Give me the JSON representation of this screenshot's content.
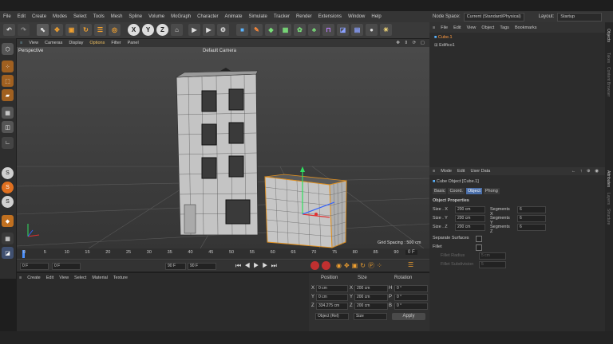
{
  "menubar": {
    "items": [
      "File",
      "Edit",
      "Create",
      "Modes",
      "Select",
      "Tools",
      "Mesh",
      "Spline",
      "Volume",
      "MoGraph",
      "Character",
      "Animate",
      "Simulate",
      "Tracker",
      "Render",
      "Extensions",
      "Window",
      "Help"
    ]
  },
  "nodespace": {
    "label": "Node Space:",
    "value": "Current (Standard/Physical)",
    "layout_label": "Layout:",
    "layout_value": "Startup"
  },
  "toolbar": {
    "x": "X",
    "y": "Y",
    "z": "Z"
  },
  "viewport": {
    "menu": [
      "View",
      "Cameras",
      "Display",
      "Options",
      "Filter",
      "Panel"
    ],
    "name": "Perspective",
    "camera": "Default Camera",
    "grid_spacing": "Grid Spacing : 500 cm"
  },
  "timeline": {
    "ticks": [
      "0",
      "5",
      "10",
      "15",
      "20",
      "25",
      "30",
      "35",
      "40",
      "45",
      "50",
      "55",
      "60",
      "65",
      "70",
      "75",
      "80",
      "85",
      "90"
    ],
    "current": "0 F",
    "start": "0 F",
    "start2": "0 F",
    "end": "90 F",
    "end2": "90 F"
  },
  "materials": {
    "menu": [
      "Create",
      "Edit",
      "View",
      "Select",
      "Material",
      "Texture"
    ]
  },
  "coordinates": {
    "headers": [
      "Position",
      "Size",
      "Rotation"
    ],
    "rows": [
      {
        "axis": "X",
        "pos": "0 cm",
        "size_axis": "X",
        "size": "200 cm",
        "rot_axis": "H",
        "rot": "0 °"
      },
      {
        "axis": "Y",
        "pos": "0 cm",
        "size_axis": "Y",
        "size": "200 cm",
        "rot_axis": "P",
        "rot": "0 °"
      },
      {
        "axis": "Z",
        "pos": "334.275 cm",
        "size_axis": "Z",
        "size": "200 cm",
        "rot_axis": "B",
        "rot": "0 °"
      }
    ],
    "mode": "Object (Rel)",
    "size_mode": "Size",
    "apply": "Apply"
  },
  "objects": {
    "menu": [
      "File",
      "Edit",
      "View",
      "Object",
      "Tags",
      "Bookmarks"
    ],
    "items": [
      "Cube.1",
      "Edifico1"
    ]
  },
  "attributes": {
    "menu": [
      "Mode",
      "Edit",
      "User Data"
    ],
    "title": "Cube Object [Cube.1]",
    "tabs": [
      "Basic",
      "Coord.",
      "Object",
      "Phong"
    ],
    "section": "Object Properties",
    "props": [
      {
        "label": "Size . X",
        "value": "200 cm",
        "seg_label": "Segments X",
        "seg": "6"
      },
      {
        "label": "Size . Y",
        "value": "200 cm",
        "seg_label": "Segments Y",
        "seg": "6"
      },
      {
        "label": "Size . Z",
        "value": "200 cm",
        "seg_label": "Segments Z",
        "seg": "6"
      }
    ],
    "separate": "Separate Surfaces",
    "fillet": "Fillet",
    "fillet_radius": "Fillet Radius",
    "fillet_radius_val": "5 cm",
    "fillet_sub": "Fillet Subdivision",
    "fillet_sub_val": "5"
  },
  "side_tabs": {
    "objects": "Objects",
    "takes": "Takes",
    "content": "Content Browser",
    "attributes": "Attributes",
    "layers": "Layers",
    "structure": "Structure"
  }
}
